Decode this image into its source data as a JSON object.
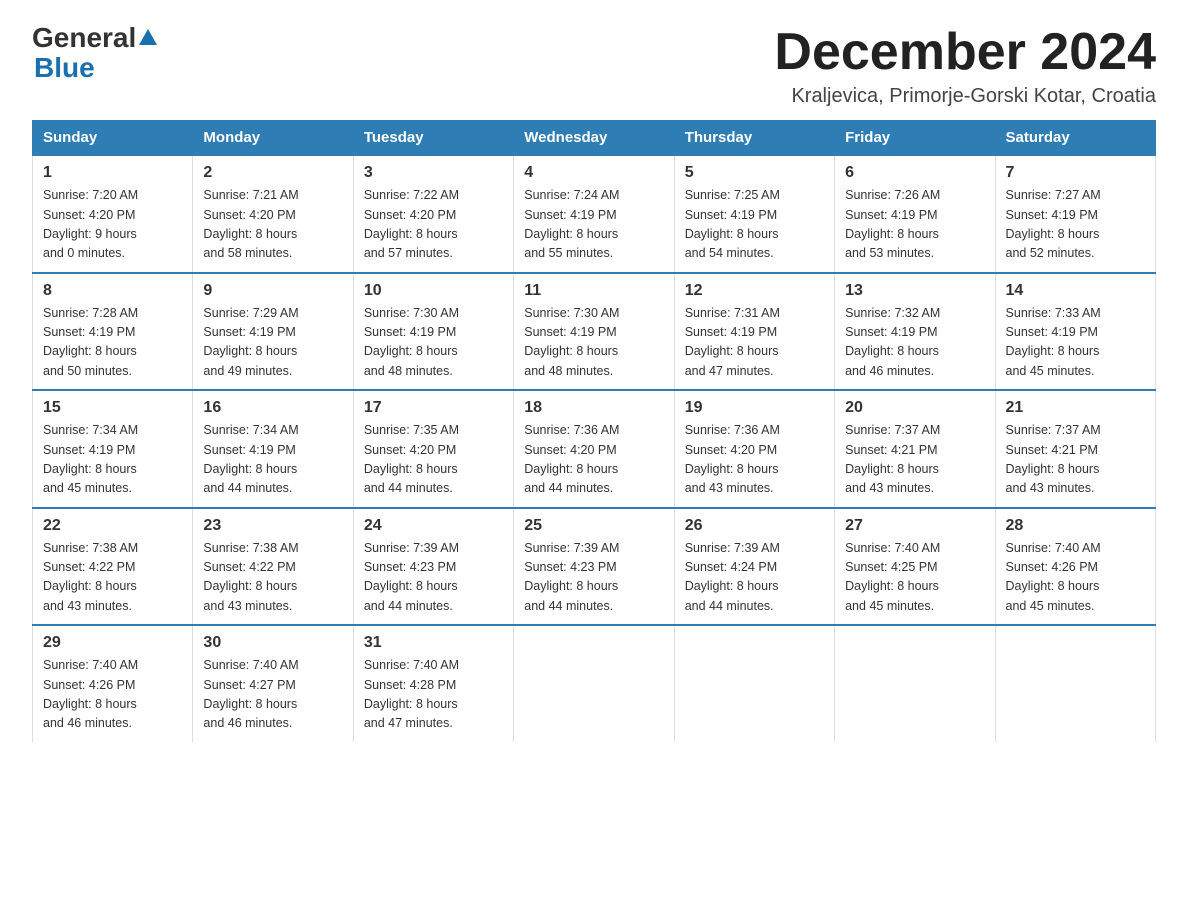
{
  "logo": {
    "general": "General",
    "blue": "Blue"
  },
  "title": "December 2024",
  "subtitle": "Kraljevica, Primorje-Gorski Kotar, Croatia",
  "days_of_week": [
    "Sunday",
    "Monday",
    "Tuesday",
    "Wednesday",
    "Thursday",
    "Friday",
    "Saturday"
  ],
  "weeks": [
    [
      {
        "day": "1",
        "sunrise": "7:20 AM",
        "sunset": "4:20 PM",
        "daylight": "9 hours and 0 minutes."
      },
      {
        "day": "2",
        "sunrise": "7:21 AM",
        "sunset": "4:20 PM",
        "daylight": "8 hours and 58 minutes."
      },
      {
        "day": "3",
        "sunrise": "7:22 AM",
        "sunset": "4:20 PM",
        "daylight": "8 hours and 57 minutes."
      },
      {
        "day": "4",
        "sunrise": "7:24 AM",
        "sunset": "4:19 PM",
        "daylight": "8 hours and 55 minutes."
      },
      {
        "day": "5",
        "sunrise": "7:25 AM",
        "sunset": "4:19 PM",
        "daylight": "8 hours and 54 minutes."
      },
      {
        "day": "6",
        "sunrise": "7:26 AM",
        "sunset": "4:19 PM",
        "daylight": "8 hours and 53 minutes."
      },
      {
        "day": "7",
        "sunrise": "7:27 AM",
        "sunset": "4:19 PM",
        "daylight": "8 hours and 52 minutes."
      }
    ],
    [
      {
        "day": "8",
        "sunrise": "7:28 AM",
        "sunset": "4:19 PM",
        "daylight": "8 hours and 50 minutes."
      },
      {
        "day": "9",
        "sunrise": "7:29 AM",
        "sunset": "4:19 PM",
        "daylight": "8 hours and 49 minutes."
      },
      {
        "day": "10",
        "sunrise": "7:30 AM",
        "sunset": "4:19 PM",
        "daylight": "8 hours and 48 minutes."
      },
      {
        "day": "11",
        "sunrise": "7:30 AM",
        "sunset": "4:19 PM",
        "daylight": "8 hours and 48 minutes."
      },
      {
        "day": "12",
        "sunrise": "7:31 AM",
        "sunset": "4:19 PM",
        "daylight": "8 hours and 47 minutes."
      },
      {
        "day": "13",
        "sunrise": "7:32 AM",
        "sunset": "4:19 PM",
        "daylight": "8 hours and 46 minutes."
      },
      {
        "day": "14",
        "sunrise": "7:33 AM",
        "sunset": "4:19 PM",
        "daylight": "8 hours and 45 minutes."
      }
    ],
    [
      {
        "day": "15",
        "sunrise": "7:34 AM",
        "sunset": "4:19 PM",
        "daylight": "8 hours and 45 minutes."
      },
      {
        "day": "16",
        "sunrise": "7:34 AM",
        "sunset": "4:19 PM",
        "daylight": "8 hours and 44 minutes."
      },
      {
        "day": "17",
        "sunrise": "7:35 AM",
        "sunset": "4:20 PM",
        "daylight": "8 hours and 44 minutes."
      },
      {
        "day": "18",
        "sunrise": "7:36 AM",
        "sunset": "4:20 PM",
        "daylight": "8 hours and 44 minutes."
      },
      {
        "day": "19",
        "sunrise": "7:36 AM",
        "sunset": "4:20 PM",
        "daylight": "8 hours and 43 minutes."
      },
      {
        "day": "20",
        "sunrise": "7:37 AM",
        "sunset": "4:21 PM",
        "daylight": "8 hours and 43 minutes."
      },
      {
        "day": "21",
        "sunrise": "7:37 AM",
        "sunset": "4:21 PM",
        "daylight": "8 hours and 43 minutes."
      }
    ],
    [
      {
        "day": "22",
        "sunrise": "7:38 AM",
        "sunset": "4:22 PM",
        "daylight": "8 hours and 43 minutes."
      },
      {
        "day": "23",
        "sunrise": "7:38 AM",
        "sunset": "4:22 PM",
        "daylight": "8 hours and 43 minutes."
      },
      {
        "day": "24",
        "sunrise": "7:39 AM",
        "sunset": "4:23 PM",
        "daylight": "8 hours and 44 minutes."
      },
      {
        "day": "25",
        "sunrise": "7:39 AM",
        "sunset": "4:23 PM",
        "daylight": "8 hours and 44 minutes."
      },
      {
        "day": "26",
        "sunrise": "7:39 AM",
        "sunset": "4:24 PM",
        "daylight": "8 hours and 44 minutes."
      },
      {
        "day": "27",
        "sunrise": "7:40 AM",
        "sunset": "4:25 PM",
        "daylight": "8 hours and 45 minutes."
      },
      {
        "day": "28",
        "sunrise": "7:40 AM",
        "sunset": "4:26 PM",
        "daylight": "8 hours and 45 minutes."
      }
    ],
    [
      {
        "day": "29",
        "sunrise": "7:40 AM",
        "sunset": "4:26 PM",
        "daylight": "8 hours and 46 minutes."
      },
      {
        "day": "30",
        "sunrise": "7:40 AM",
        "sunset": "4:27 PM",
        "daylight": "8 hours and 46 minutes."
      },
      {
        "day": "31",
        "sunrise": "7:40 AM",
        "sunset": "4:28 PM",
        "daylight": "8 hours and 47 minutes."
      },
      null,
      null,
      null,
      null
    ]
  ],
  "labels": {
    "sunrise": "Sunrise:",
    "sunset": "Sunset:",
    "daylight": "Daylight:"
  }
}
